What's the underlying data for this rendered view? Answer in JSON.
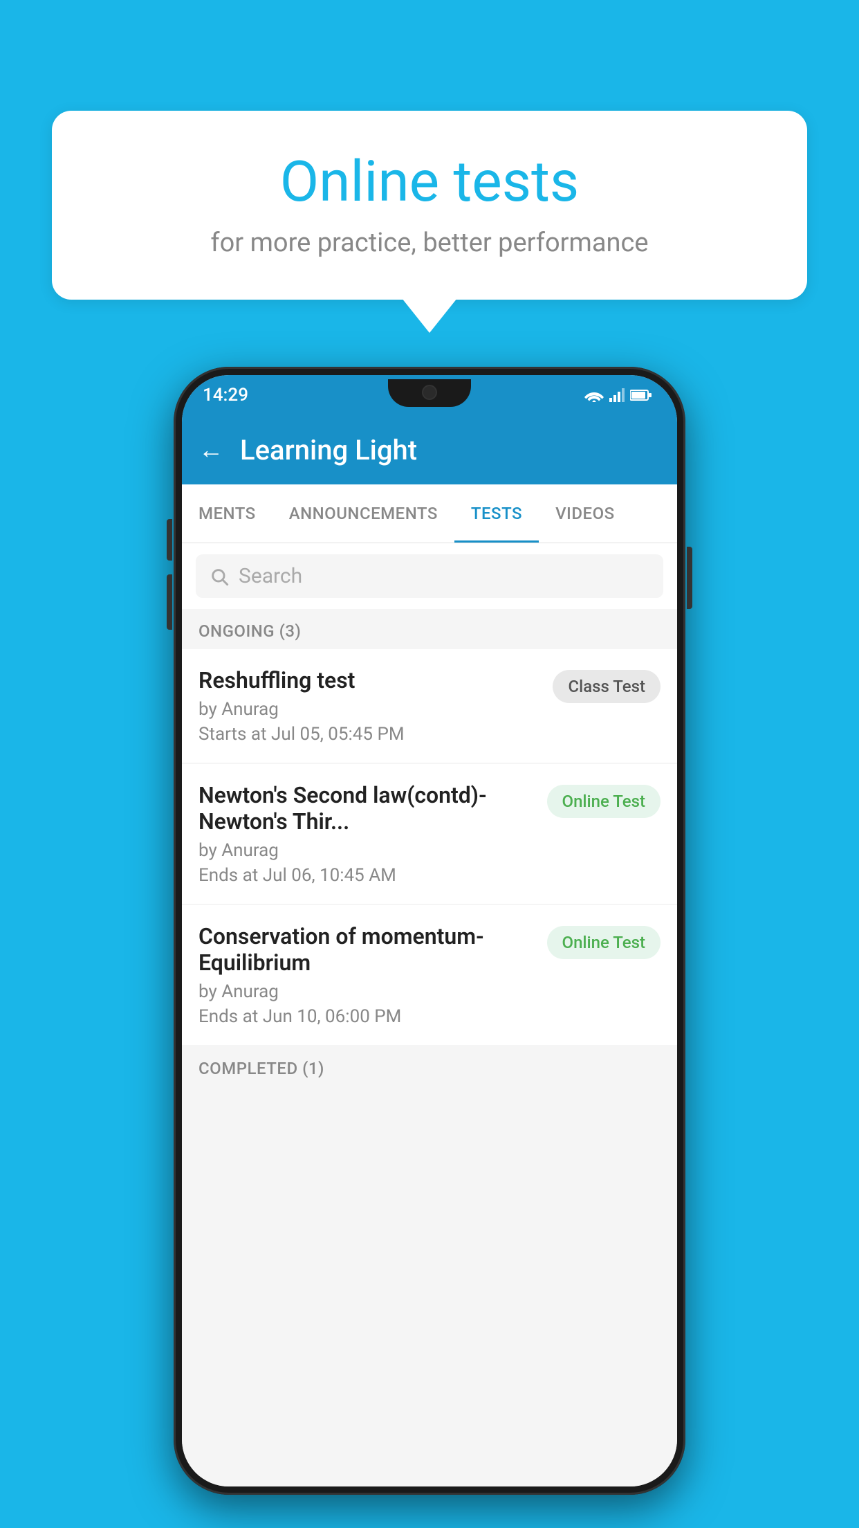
{
  "background": {
    "color": "#1ab6e8"
  },
  "speech_bubble": {
    "title": "Online tests",
    "subtitle": "for more practice, better performance"
  },
  "status_bar": {
    "time": "14:29",
    "wifi": "wifi",
    "signal": "signal",
    "battery": "battery"
  },
  "app_bar": {
    "back_label": "←",
    "title": "Learning Light"
  },
  "tabs": [
    {
      "label": "MENTS",
      "active": false
    },
    {
      "label": "ANNOUNCEMENTS",
      "active": false
    },
    {
      "label": "TESTS",
      "active": true
    },
    {
      "label": "VIDEOS",
      "active": false
    }
  ],
  "search": {
    "placeholder": "Search"
  },
  "ongoing_section": {
    "label": "ONGOING (3)"
  },
  "tests": [
    {
      "name": "Reshuffling test",
      "author": "by Anurag",
      "time_label": "Starts at",
      "time": "Jul 05, 05:45 PM",
      "badge": "Class Test",
      "badge_type": "class"
    },
    {
      "name": "Newton's Second law(contd)-Newton's Thir...",
      "author": "by Anurag",
      "time_label": "Ends at",
      "time": "Jul 06, 10:45 AM",
      "badge": "Online Test",
      "badge_type": "online"
    },
    {
      "name": "Conservation of momentum-Equilibrium",
      "author": "by Anurag",
      "time_label": "Ends at",
      "time": "Jun 10, 06:00 PM",
      "badge": "Online Test",
      "badge_type": "online"
    }
  ],
  "completed_section": {
    "label": "COMPLETED (1)"
  }
}
